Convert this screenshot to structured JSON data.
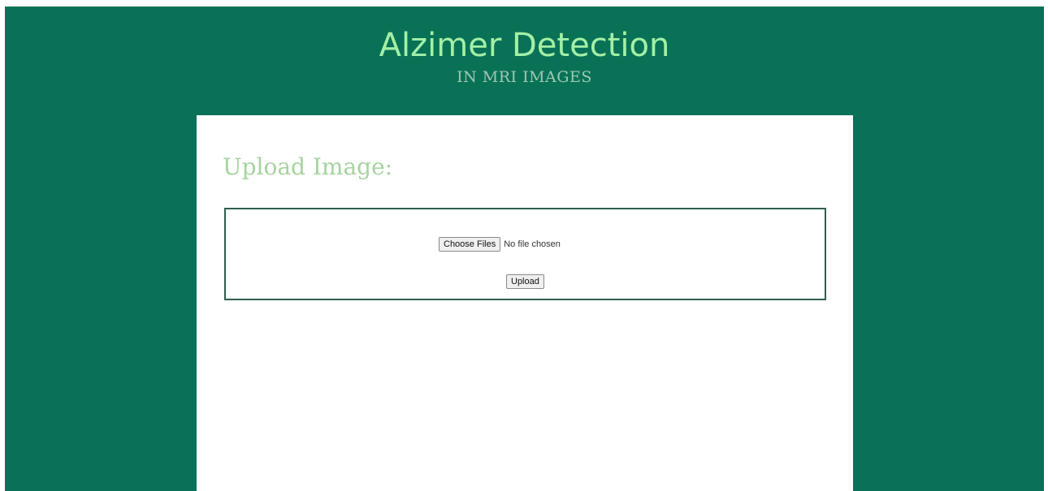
{
  "header": {
    "title": "Alzimer Detection",
    "subtitle": "IN MRI IMAGES"
  },
  "upload_section": {
    "heading": "Upload Image:",
    "choose_files_label": "Choose Files",
    "file_status": "No file chosen",
    "upload_label": "Upload"
  },
  "colors": {
    "background": "#097256",
    "title": "#a3f0a6",
    "heading": "#a6d3a0",
    "form_border": "#2f5e4d",
    "card": "#ffffff"
  }
}
